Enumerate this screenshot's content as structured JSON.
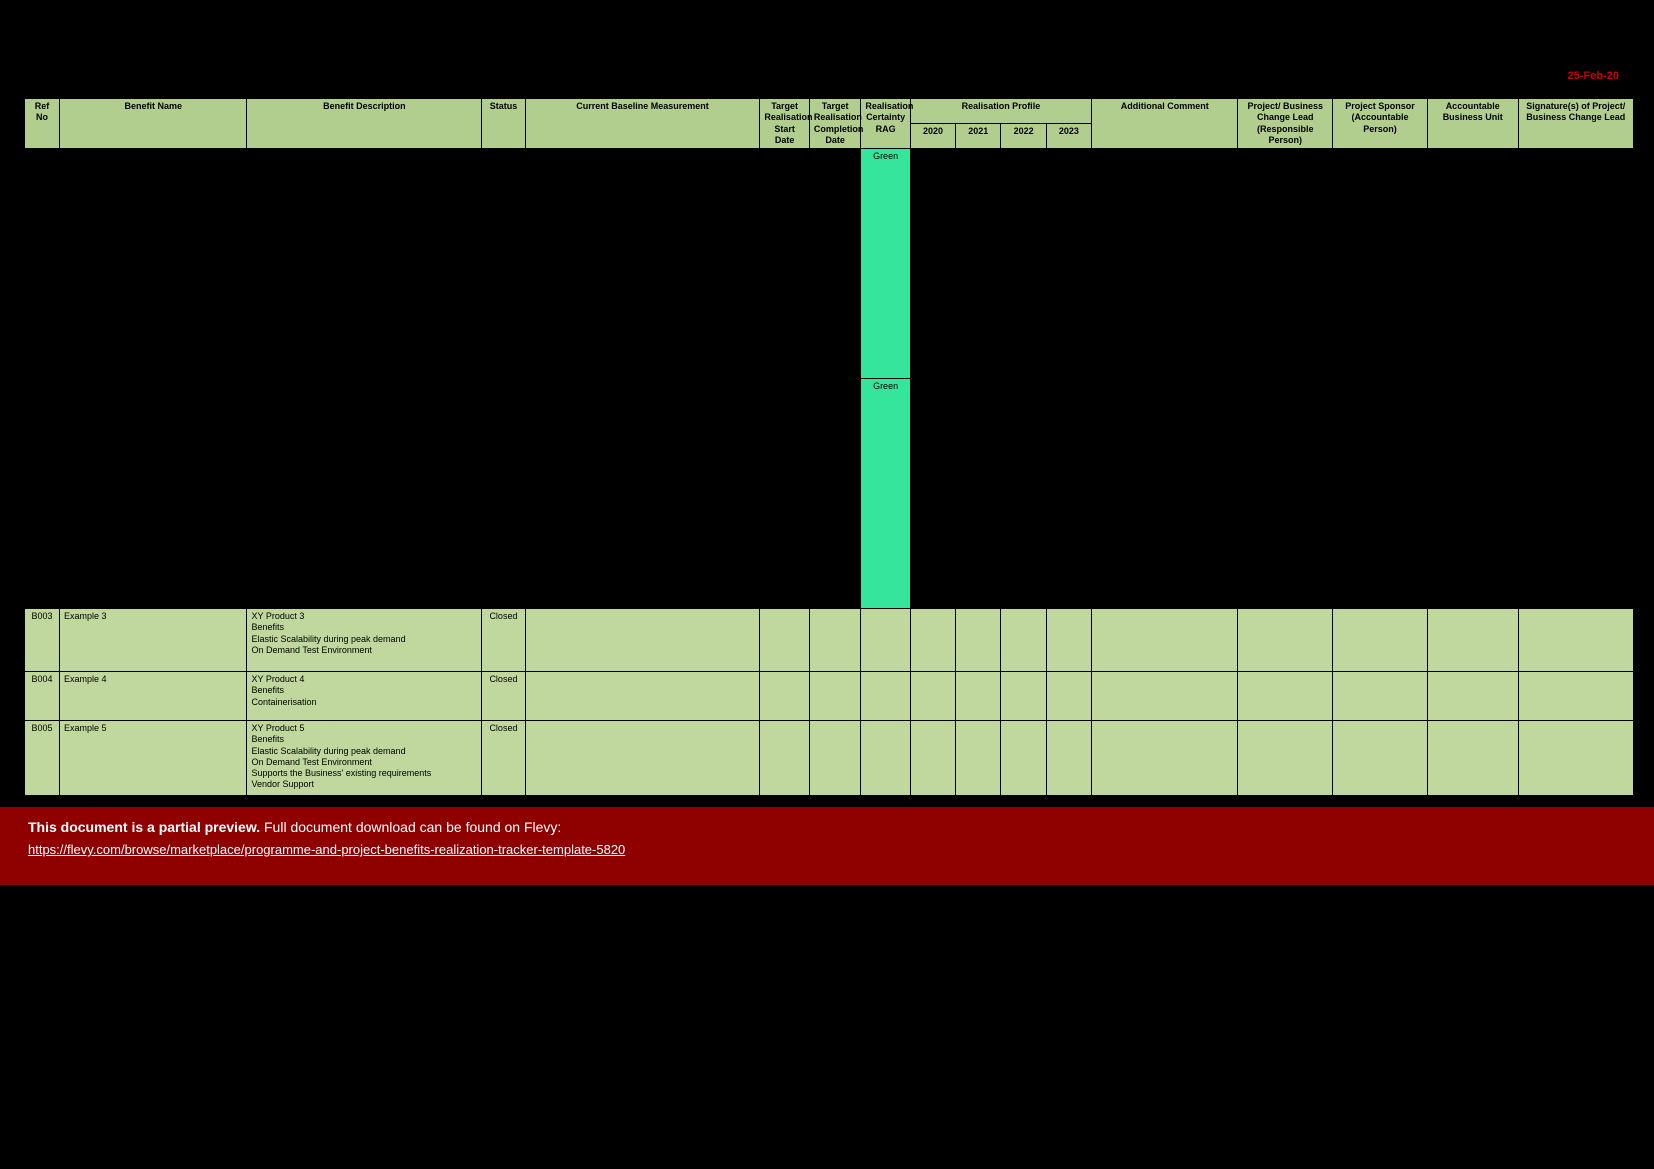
{
  "meta": {
    "date_stamp": "25-Feb-20"
  },
  "headers": {
    "ref_no": "Ref No",
    "benefit_name": "Benefit Name",
    "benefit_description": "Benefit Description",
    "status": "Status",
    "current_baseline": "Current Baseline Measurement",
    "target_start": "Target Realisation Start Date",
    "target_end": "Target Realisation Completion Date",
    "rag": "Realisation Certainty RAG",
    "profile_group": "Realisation Profile",
    "y2020": "2020",
    "y2021": "2021",
    "y2022": "2022",
    "y2023": "2023",
    "additional_comment": "Additional Comment",
    "change_lead": "Project/ Business Change Lead (Responsible Person)",
    "sponsor": "Project Sponsor (Accountable Person)",
    "accountable_unit": "Accountable Business Unit",
    "signature": "Signature(s) of Project/ Business Change Lead"
  },
  "hidden_rows": {
    "row1_rag": "Green",
    "row2_rag": "Green"
  },
  "rows": [
    {
      "ref": "B003",
      "name": "Example 3",
      "desc": "XY Product 3\nBenefits\nElastic Scalability during peak demand\nOn Demand Test Environment",
      "status": "Closed",
      "baseline": "",
      "tstart": "",
      "tend": "",
      "rag": "",
      "y2020": "",
      "y2021": "",
      "y2022": "",
      "y2023": "",
      "comment": "",
      "lead": "",
      "sponsor": "",
      "unit": "",
      "sig": ""
    },
    {
      "ref": "B004",
      "name": "Example 4",
      "desc": "XY Product 4\nBenefits\nContainerisation",
      "status": "Closed",
      "baseline": "",
      "tstart": "",
      "tend": "",
      "rag": "",
      "y2020": "",
      "y2021": "",
      "y2022": "",
      "y2023": "",
      "comment": "",
      "lead": "",
      "sponsor": "",
      "unit": "",
      "sig": ""
    },
    {
      "ref": "B005",
      "name": "Example 5",
      "desc": "XY Product 5\nBenefits\nElastic Scalability during peak demand\nOn Demand Test Environment\nSupports the Business' existing requirements\nVendor Support",
      "status": "Closed",
      "baseline": "",
      "tstart": "",
      "tend": "",
      "rag": "",
      "y2020": "",
      "y2021": "",
      "y2022": "",
      "y2023": "",
      "comment": "",
      "lead": "",
      "sponsor": "",
      "unit": "",
      "sig": ""
    }
  ],
  "banner": {
    "lead": "This document is a partial preview.",
    "rest": "Full document download can be found on Flevy:",
    "link_text": "https://flevy.com/browse/marketplace/programme-and-project-benefits-realization-tracker-template-5820",
    "link_href": "https://flevy.com/browse/marketplace/programme-and-project-benefits-realization-tracker-template-5820"
  }
}
